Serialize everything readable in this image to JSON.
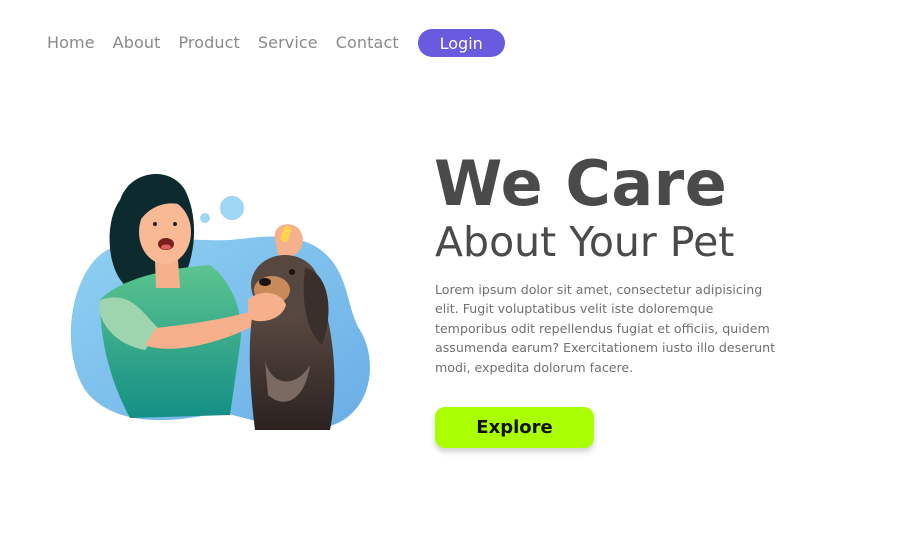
{
  "nav": {
    "links": [
      "Home",
      "About",
      "Product",
      "Service",
      "Contact"
    ],
    "login_label": "Login"
  },
  "hero": {
    "title": "We Care",
    "subtitle": "About Your Pet",
    "description": "Lorem ipsum dolor sit amet, consectetur adipisicing elit. Fugit voluptatibus velit iste doloremque temporibus odit repellendus fugiat et officiis, quidem assumenda earum? Exercitationem iusto illo deserunt modi, expedita dolorum facere.",
    "cta_label": "Explore"
  },
  "illustration": {
    "icon": "woman-with-dog-illustration"
  },
  "colors": {
    "accent": "#6a5ae0",
    "cta": "#aaff00",
    "heading": "#4a4a4a",
    "nav_text": "#8a8a8a",
    "blob": "#7fc4ec"
  }
}
